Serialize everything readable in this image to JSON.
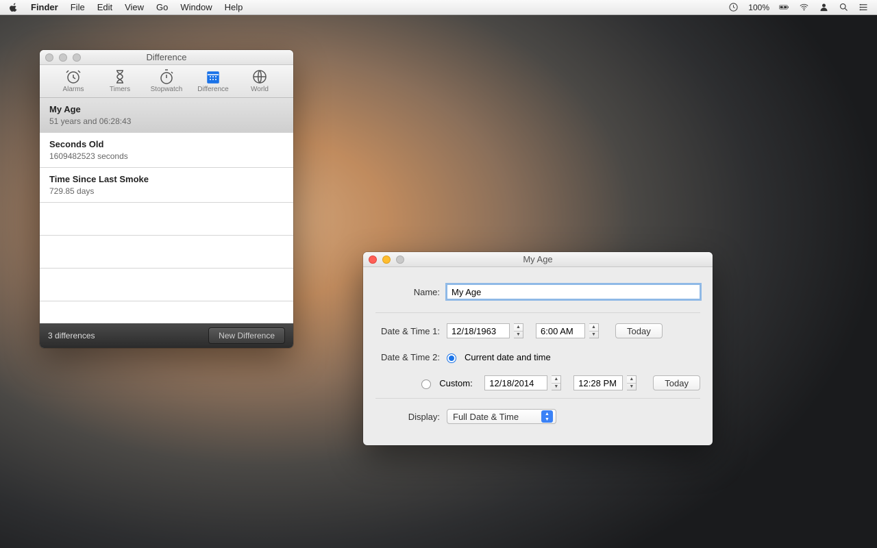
{
  "menubar": {
    "app": "Finder",
    "items": [
      "File",
      "Edit",
      "View",
      "Go",
      "Window",
      "Help"
    ],
    "battery": "100%"
  },
  "diffWindow": {
    "title": "Difference",
    "tabs": {
      "alarms": "Alarms",
      "timers": "Timers",
      "stopwatch": "Stopwatch",
      "difference": "Difference",
      "world": "World"
    },
    "rows": [
      {
        "title": "My Age",
        "sub": "51 years and 06:28:43"
      },
      {
        "title": "Seconds Old",
        "sub": "1609482523 seconds"
      },
      {
        "title": "Time Since Last Smoke",
        "sub": "729.85 days"
      }
    ],
    "footer_count": "3 differences",
    "footer_btn": "New Difference"
  },
  "ageWindow": {
    "title": "My Age",
    "labels": {
      "name": "Name:",
      "dt1": "Date & Time 1:",
      "dt2": "Date & Time 2:",
      "display": "Display:"
    },
    "name_value": "My Age",
    "dt1_date": "12/18/1963",
    "dt1_time": "6:00 AM",
    "today_btn": "Today",
    "radio_current": "Current date and time",
    "radio_custom": "Custom:",
    "dt2_date": "12/18/2014",
    "dt2_time": "12:28 PM",
    "display_value": "Full Date & Time"
  }
}
